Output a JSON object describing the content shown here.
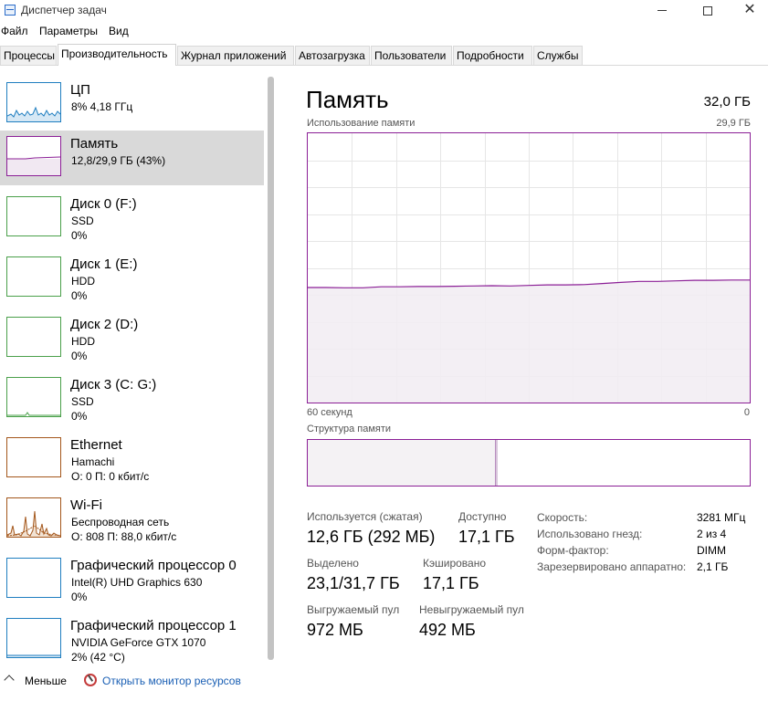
{
  "window": {
    "title": "Диспетчер задач"
  },
  "menu": [
    "Файл",
    "Параметры",
    "Вид"
  ],
  "tabs": [
    "Процессы",
    "Производительность",
    "Журнал приложений",
    "Автозагрузка",
    "Пользователи",
    "Подробности",
    "Службы"
  ],
  "active_tab": "Производительность",
  "sidebar": [
    {
      "name": "ЦП",
      "sub": "8% 4,18 ГГц",
      "color": "#1f7ec0"
    },
    {
      "name": "Память",
      "sub": "12,8/29,9 ГБ (43%)",
      "color": "#8b1f96"
    },
    {
      "name": "Диск 0 (F:)",
      "sub": "SSD",
      "sub2": "0%",
      "color": "#4aa04a"
    },
    {
      "name": "Диск 1 (E:)",
      "sub": "HDD",
      "sub2": "0%",
      "color": "#4aa04a"
    },
    {
      "name": "Диск 2 (D:)",
      "sub": "HDD",
      "sub2": "0%",
      "color": "#4aa04a"
    },
    {
      "name": "Диск 3 (C: G:)",
      "sub": "SSD",
      "sub2": "0%",
      "color": "#4aa04a"
    },
    {
      "name": "Ethernet",
      "sub": "Hamachi",
      "sub2": "О: 0 П: 0 кбит/с",
      "color": "#a3561b"
    },
    {
      "name": "Wi-Fi",
      "sub": "Беспроводная сеть",
      "sub2": "О: 808 П: 88,0 кбит/с",
      "color": "#a3561b"
    },
    {
      "name": "Графический процессор 0",
      "sub": "Intel(R) UHD Graphics 630",
      "sub2": "0%",
      "color": "#1f7ec0"
    },
    {
      "name": "Графический процессор 1",
      "sub": "NVIDIA GeForce GTX 1070",
      "sub2": "2% (42 °C)",
      "color": "#1f7ec0"
    }
  ],
  "main": {
    "title": "Память",
    "total": "32,0 ГБ",
    "graph_label": "Использование памяти",
    "graph_max": "29,9 ГБ",
    "axis_left": "60 секунд",
    "axis_right": "0",
    "struct_label": "Структура памяти",
    "stats": {
      "in_use_label": "Используется (сжатая)",
      "in_use_value": "12,6 ГБ (292 МБ)",
      "available_label": "Доступно",
      "available_value": "17,1 ГБ",
      "committed_label": "Выделено",
      "committed_value": "23,1/31,7 ГБ",
      "cached_label": "Кэшировано",
      "cached_value": "17,1 ГБ",
      "paged_label": "Выгружаемый пул",
      "paged_value": "972 МБ",
      "nonpaged_label": "Невыгружаемый пул",
      "nonpaged_value": "492 МБ"
    },
    "props": [
      {
        "label": "Скорость:",
        "value": "3281 МГц"
      },
      {
        "label": "Использовано гнезд:",
        "value": "2 из 4"
      },
      {
        "label": "Форм-фактор:",
        "value": "DIMM"
      },
      {
        "label": "Зарезервировано аппаратно:",
        "value": "2,1 ГБ"
      }
    ]
  },
  "footer": {
    "less": "Меньше",
    "resource_monitor": "Открыть монитор ресурсов"
  },
  "memory_usage_history": [
    0.427,
    0.427,
    0.426,
    0.426,
    0.43,
    0.43,
    0.431,
    0.431,
    0.432,
    0.433,
    0.434,
    0.433,
    0.435,
    0.437,
    0.437,
    0.438,
    0.442,
    0.446,
    0.45,
    0.45,
    0.452,
    0.454,
    0.454,
    0.455,
    0.455
  ],
  "colors": {
    "memory": "#8b1f96",
    "cpu": "#1f7ec0",
    "disk": "#4aa04a",
    "network": "#a3561b"
  }
}
